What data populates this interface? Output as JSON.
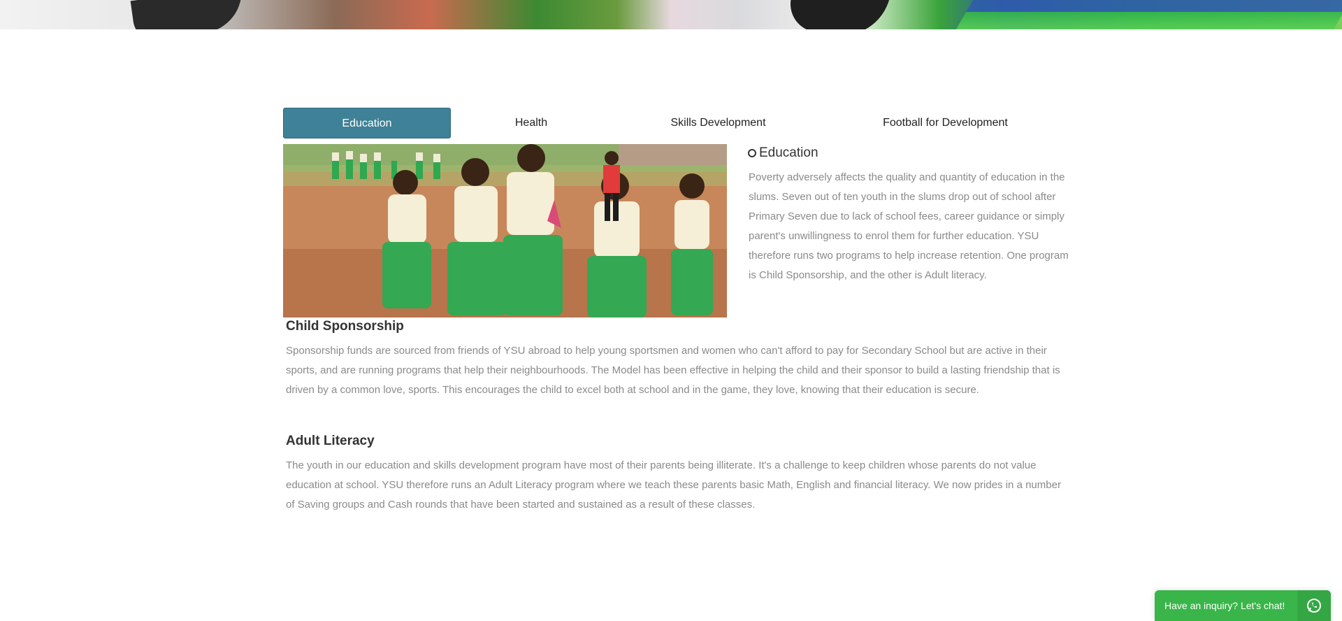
{
  "tabs": [
    {
      "label": "Education",
      "active": true
    },
    {
      "label": "Health",
      "active": false
    },
    {
      "label": "Skills Development",
      "active": false
    },
    {
      "label": "Football for Development",
      "active": false
    }
  ],
  "education": {
    "heading": "Education",
    "paragraph": "Poverty adversely affects the quality and quantity of education in the slums. Seven out of ten youth in the slums drop out of school after Primary Seven due to lack of school fees, career guidance or simply parent's unwillingness to enrol them for further education. YSU therefore runs two programs to help increase retention. One program is Child Sponsorship, and the other is Adult literacy."
  },
  "child_sponsorship": {
    "title": "Child Sponsorship",
    "paragraph": "Sponsorship funds are sourced from friends of YSU abroad to help young sportsmen and women who can't afford to pay for Secondary School but are active in their sports, and are running programs that help their neighbourhoods. The Model has been effective in helping the child and their sponsor to build a lasting friendship that is driven by a common love, sports. This encourages the child to excel both at school and in the game, they love, knowing that their education is secure."
  },
  "adult_literacy": {
    "title": "Adult Literacy",
    "paragraph": "The youth in our education and skills development program have most of their parents being illiterate. It's a challenge to keep children whose parents do not value education at school. YSU therefore runs an Adult Literacy program where we teach these parents basic Math, English and financial literacy. We now prides in a number of Saving groups and Cash rounds that have been started and sustained as a result of these classes."
  },
  "chat": {
    "label": "Have an inquiry? Let's chat!",
    "icon": "whatsapp-icon"
  },
  "colors": {
    "active_tab": "#3f8196",
    "chat_green": "#3ab54a",
    "body_text": "#8a8a8a",
    "heading_text": "#333333"
  }
}
